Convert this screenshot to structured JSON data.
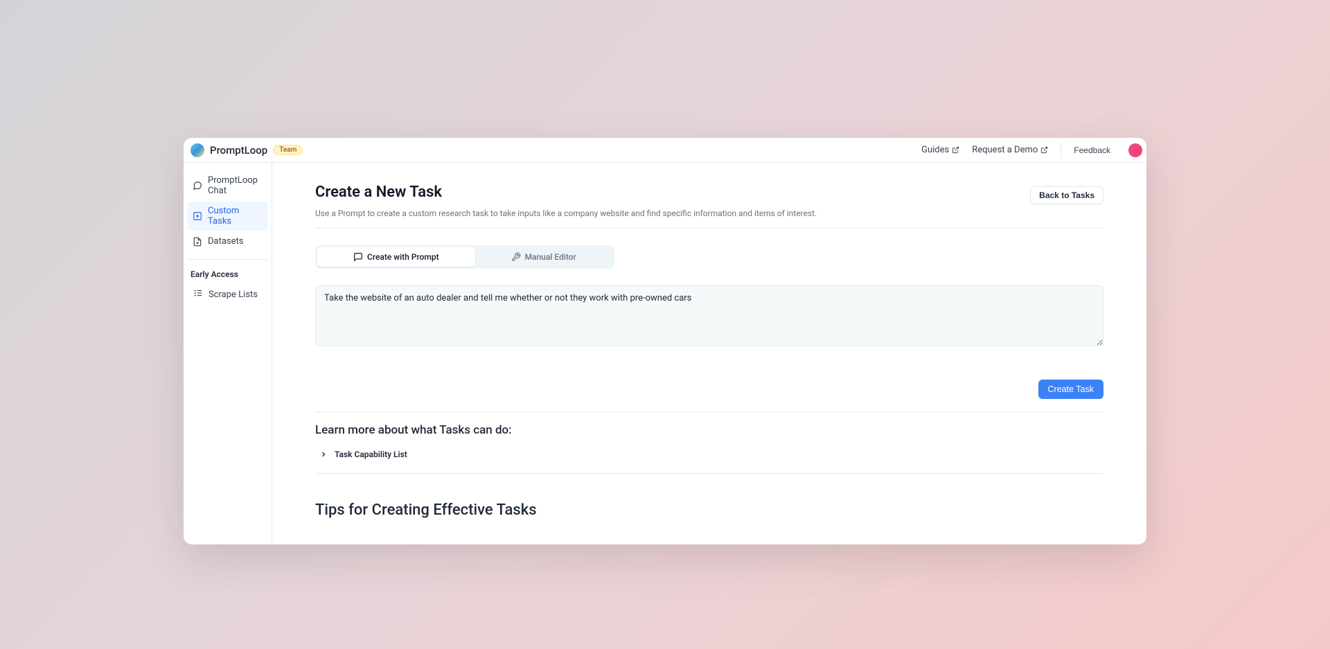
{
  "header": {
    "brand": "PromptLoop",
    "badge": "Team",
    "links": {
      "guides": "Guides",
      "request_demo": "Request a Demo",
      "feedback": "Feedback"
    }
  },
  "sidebar": {
    "items": [
      {
        "label": "PromptLoop Chat"
      },
      {
        "label": "Custom Tasks"
      },
      {
        "label": "Datasets"
      }
    ],
    "early_access_heading": "Early Access",
    "early_access_items": [
      {
        "label": "Scrape Lists"
      }
    ]
  },
  "main": {
    "title": "Create a New Task",
    "subtitle": "Use a Prompt to create a custom research task to take inputs like a company website and find specific information and items of interest.",
    "back_button": "Back to Tasks",
    "tabs": {
      "create_with_prompt": "Create with Prompt",
      "manual_editor": "Manual Editor"
    },
    "textarea_value": "Take the website of an auto dealer and tell me whether or not they work with pre-owned cars",
    "create_task_button": "Create Task",
    "learn_more_title": "Learn more about what Tasks can do:",
    "capability_list_label": "Task Capability List",
    "tips_title": "Tips for Creating Effective Tasks"
  }
}
